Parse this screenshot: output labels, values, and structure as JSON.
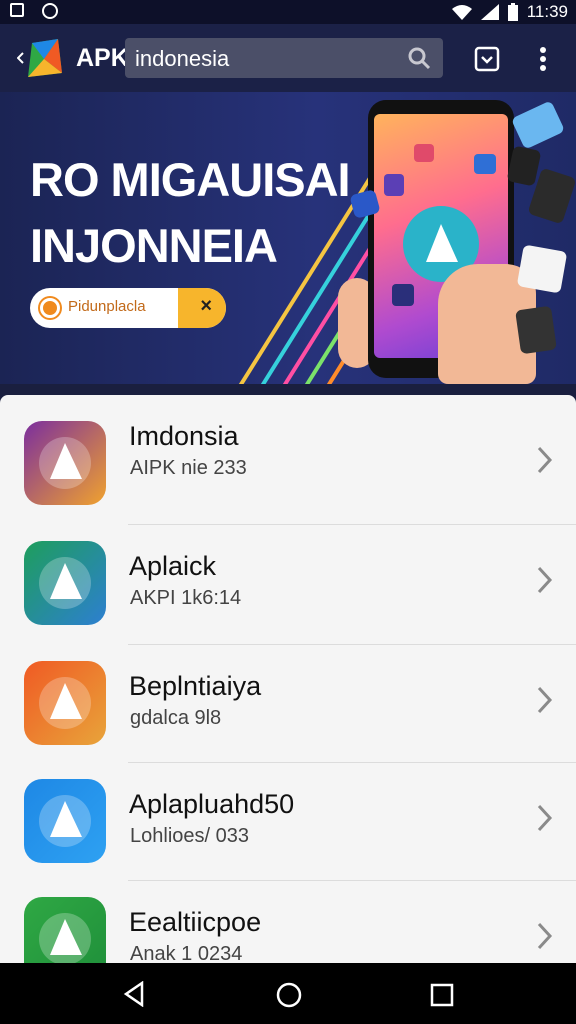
{
  "status_bar": {
    "time": "11:39"
  },
  "app_bar": {
    "brand": "APK",
    "search_value": "indonesia"
  },
  "banner": {
    "title_line1": "RO MIGAUISAI",
    "title_line2": "INJONNEIA",
    "chip_label": "Pidunplacla",
    "chip_close": "×"
  },
  "apps": [
    {
      "name": "Imdonsia",
      "subtitle": "AIPK nie 233",
      "icon_colors": [
        "#7b2e9e",
        "#f0a22e"
      ]
    },
    {
      "name": "Aplaick",
      "subtitle": "AKPI 1k6:14",
      "icon_colors": [
        "#1e9e5c",
        "#2d7fd1"
      ]
    },
    {
      "name": "Beplntiaiya",
      "subtitle": "gdalca 9l8",
      "icon_colors": [
        "#f05a24",
        "#e8a43a"
      ]
    },
    {
      "name": "Aplapluahd50",
      "subtitle": "Lohlioes/ 033",
      "icon_colors": [
        "#1e88e5",
        "#2ea1f2"
      ]
    },
    {
      "name": "Eealtiicpoe",
      "subtitle": "Anak 1 0234",
      "icon_colors": [
        "#2fa844",
        "#1f8f3a"
      ]
    }
  ],
  "nav_bar": {
    "icons": [
      "back-icon",
      "home-icon",
      "recents-icon"
    ]
  }
}
